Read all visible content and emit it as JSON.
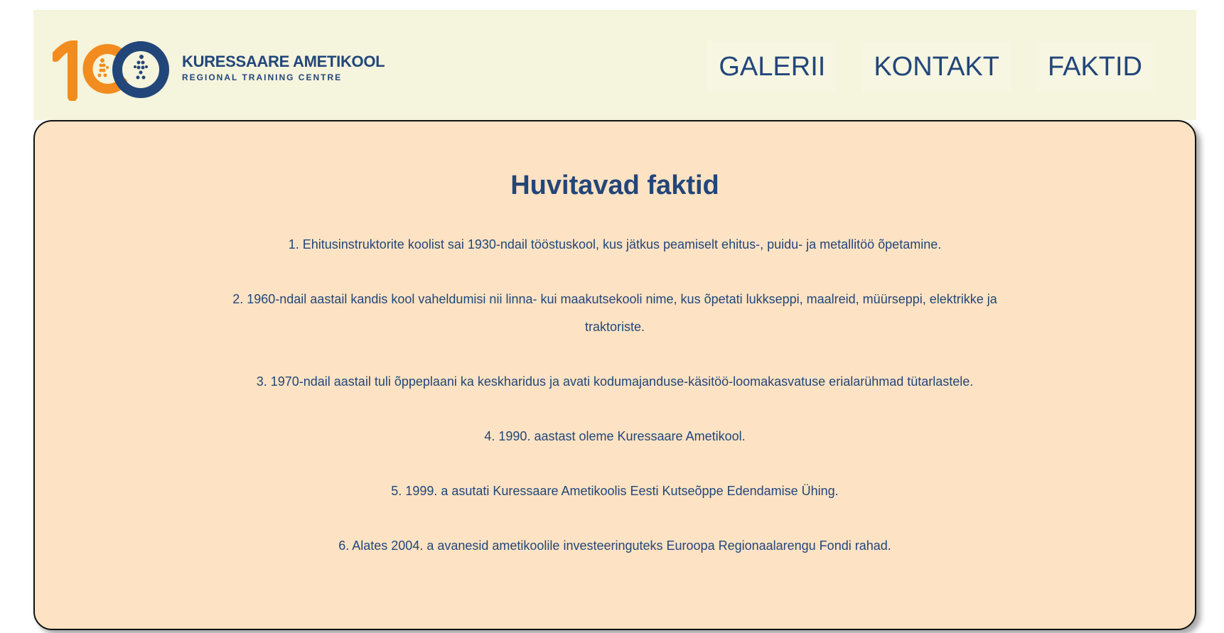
{
  "header": {
    "logo": {
      "name": "KURESSAARE AMETIKOOL",
      "subtitle": "REGIONAL TRAINING CENTRE",
      "colors": {
        "orange": "#f28c1e",
        "navy": "#23467a"
      }
    },
    "nav": [
      {
        "label": "GALERII"
      },
      {
        "label": "KONTAKT"
      },
      {
        "label": "FAKTID"
      }
    ]
  },
  "main": {
    "title": "Huvitavad faktid",
    "facts": [
      "1. Ehitusinstruktorite koolist sai 1930-ndail tööstuskool, kus jätkus peamiselt ehitus-, puidu- ja metallitöö õpetamine.",
      "2. 1960-ndail aastail kandis kool vaheldumisi nii linna- kui maakutsekooli nime, kus õpetati lukkseppi, maalreid, müürseppi, elektrikke ja traktoriste.",
      "3. 1970-ndail aastail tuli õppeplaani ka keskharidus ja avati kodumajanduse-käsitöö-loomakasvatuse erialarühmad tütarlastele.",
      "4. 1990. aastast oleme Kuressaare Ametikool.",
      "5. 1999. a asutati Kuressaare Ametikoolis Eesti Kutseõppe Edendamise Ühing.",
      "6. Alates 2004. a avanesid ametikoolile investeeringuteks Euroopa Regionaalarengu Fondi rahad."
    ]
  },
  "colors": {
    "header_bg": "#f5f4dc",
    "content_bg": "#fde3c3",
    "text": "#23467a"
  }
}
